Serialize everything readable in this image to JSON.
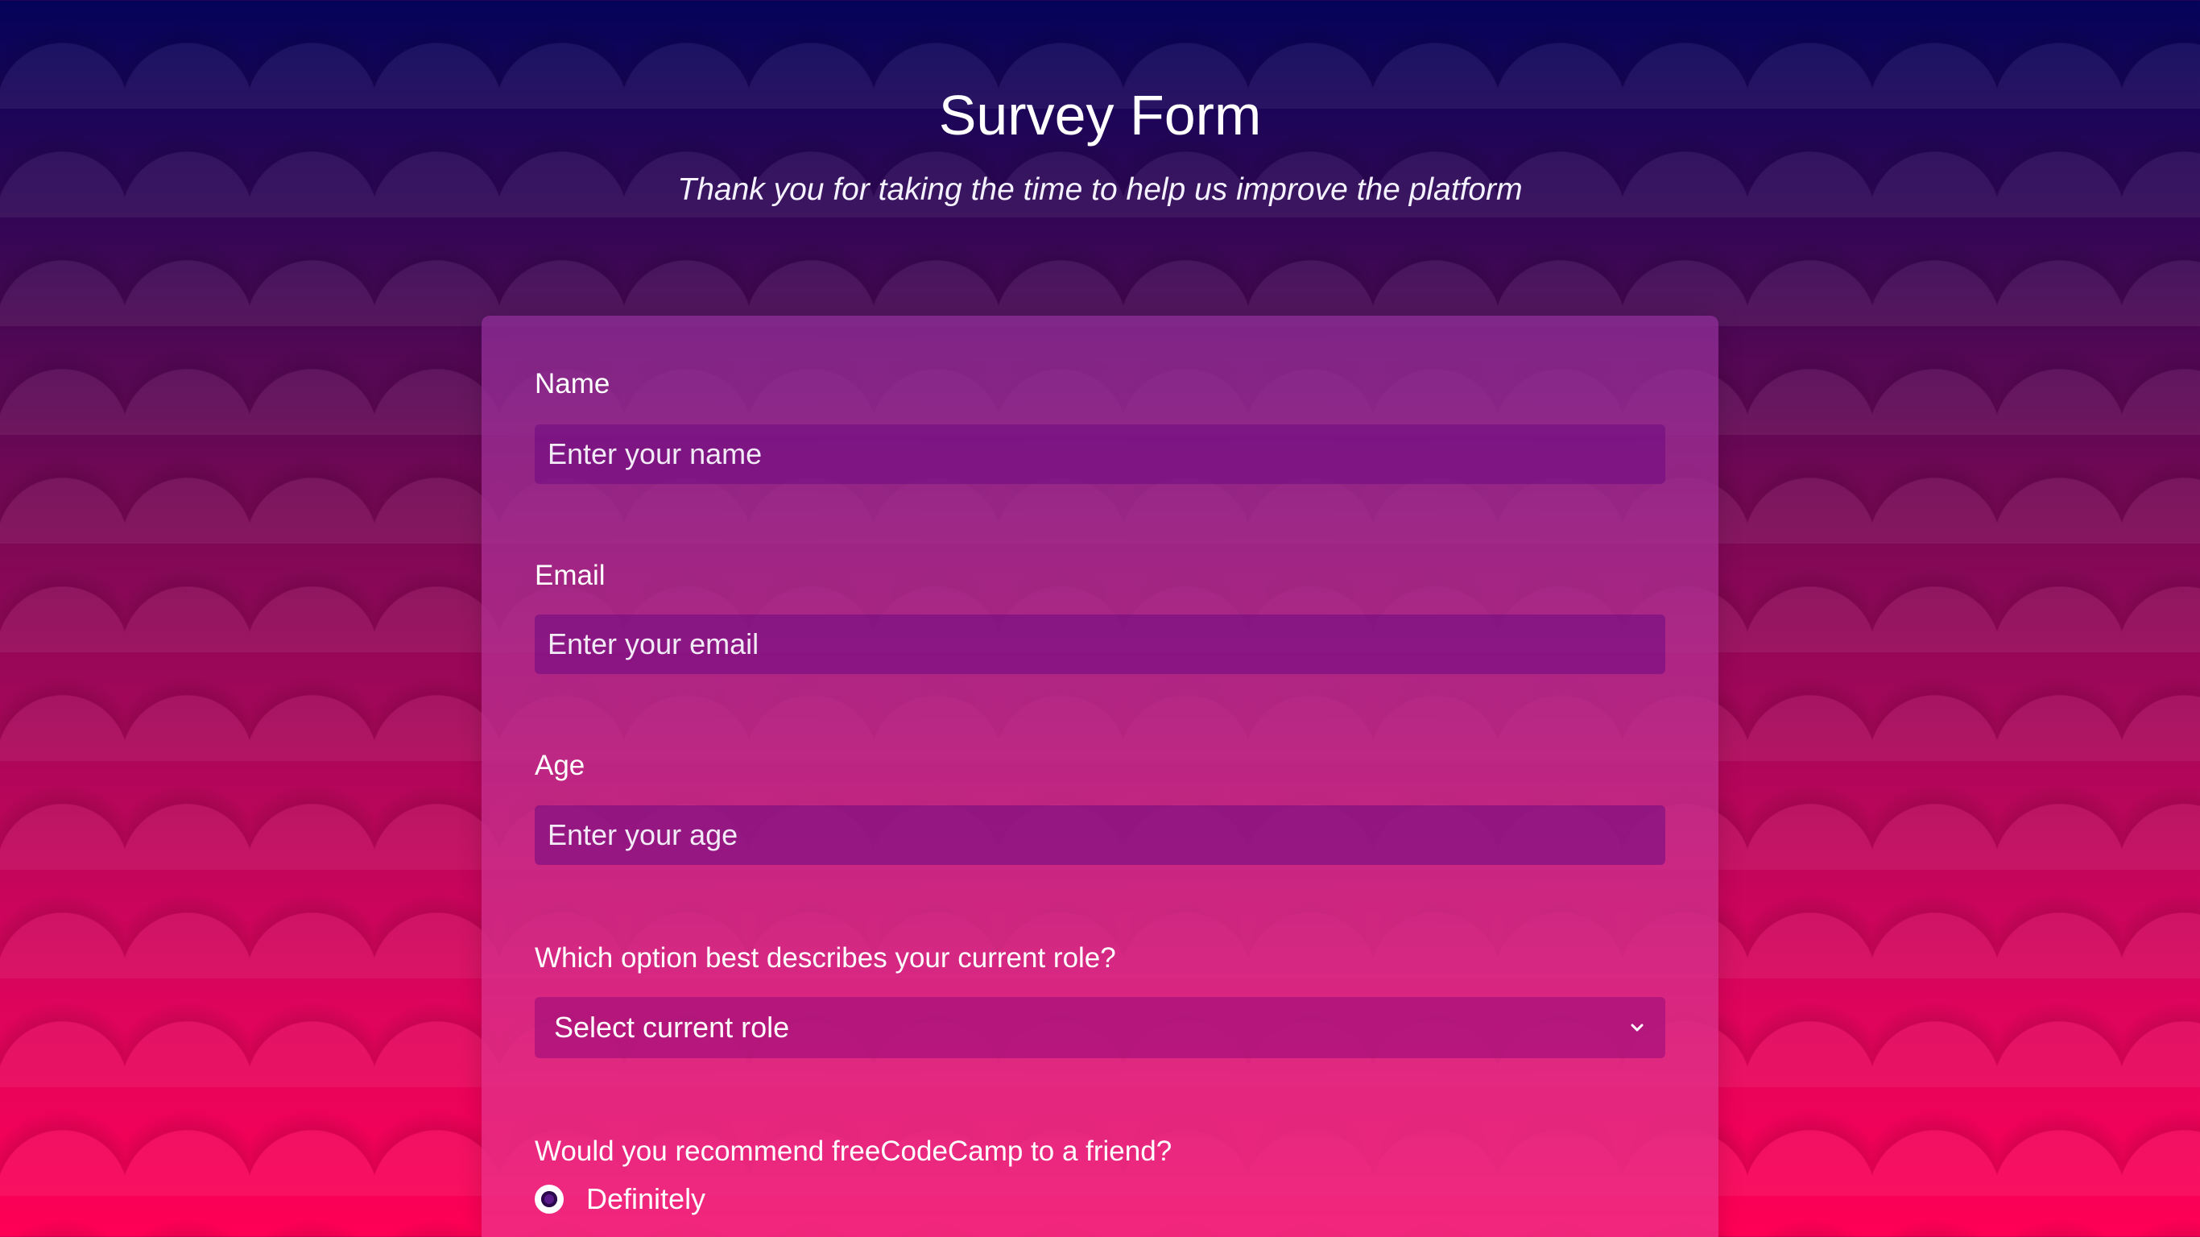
{
  "page": {
    "title": "Survey Form",
    "description": "Thank you for taking the time to help us improve the platform"
  },
  "form": {
    "name": {
      "label": "Name",
      "placeholder": "Enter your name",
      "value": ""
    },
    "email": {
      "label": "Email",
      "placeholder": "Enter your email",
      "value": ""
    },
    "age": {
      "label": "Age",
      "placeholder": "Enter your age",
      "value": ""
    },
    "role": {
      "label": "Which option best describes your current role?",
      "selected": "Select current role"
    },
    "recommend": {
      "label": "Would you recommend freeCodeCamp to a friend?",
      "options": [
        "Definitely"
      ]
    }
  },
  "colors": {
    "background_top": "#04035a",
    "background_bottom": "#ff0055",
    "text": "#ffffff"
  },
  "icons": {
    "select_arrow": "chevron-down-icon",
    "radio": "radio-button"
  }
}
